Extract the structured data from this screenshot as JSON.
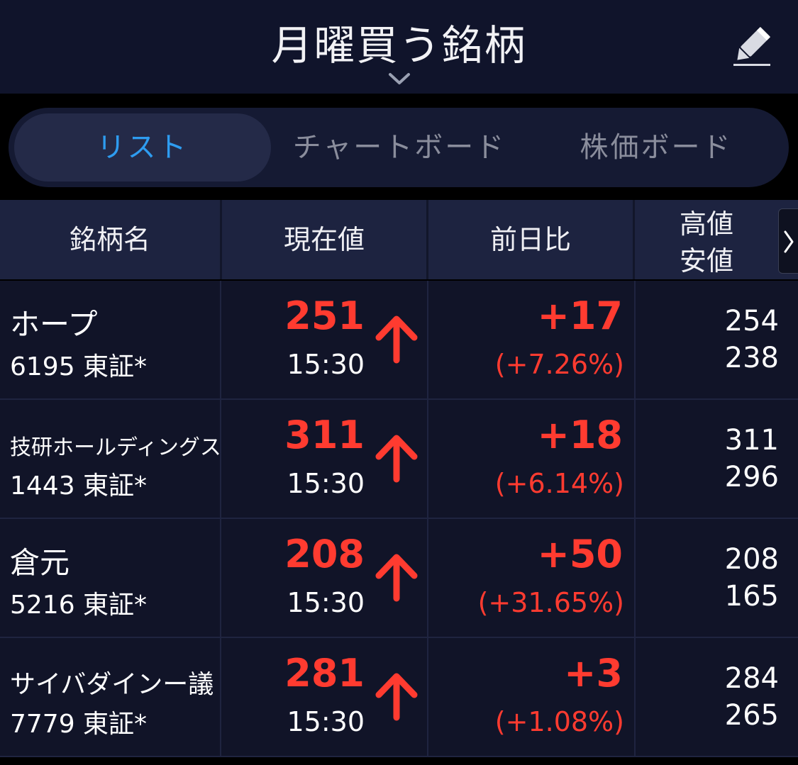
{
  "header": {
    "title": "月曜買う銘柄"
  },
  "tabs": [
    {
      "label": "リスト",
      "active": true
    },
    {
      "label": "チャートボード",
      "active": false
    },
    {
      "label": "株価ボード",
      "active": false
    }
  ],
  "table": {
    "headers": {
      "name": "銘柄名",
      "price": "現在値",
      "change": "前日比",
      "high": "高値",
      "low": "安値"
    },
    "rows": [
      {
        "name": "ホープ",
        "code": "6195 東証*",
        "price": "251",
        "time": "15:30",
        "change": "+17",
        "change_pct": "(+7.26%)",
        "high": "254",
        "low": "238",
        "direction": "up"
      },
      {
        "name": "技研ホールディングス",
        "code": "1443 東証*",
        "price": "311",
        "time": "15:30",
        "change": "+18",
        "change_pct": "(+6.14%)",
        "high": "311",
        "low": "296",
        "direction": "up"
      },
      {
        "name": "倉元",
        "code": "5216 東証*",
        "price": "208",
        "time": "15:30",
        "change": "+50",
        "change_pct": "(+31.65%)",
        "high": "208",
        "low": "165",
        "direction": "up"
      },
      {
        "name": "サイバダインー議",
        "code": "7779 東証*",
        "price": "281",
        "time": "15:30",
        "change": "+3",
        "change_pct": "(+1.08%)",
        "high": "284",
        "low": "265",
        "direction": "up"
      }
    ]
  },
  "colors": {
    "up": "#ff3b30",
    "active_tab": "#2e9cf0",
    "header_bg": "#10142b",
    "row_bg": "#111428"
  },
  "icons": {
    "edit": "pencil-icon",
    "dropdown": "chevron-down-icon",
    "scroll": "chevron-right-icon",
    "up_arrow": "arrow-up-icon"
  }
}
